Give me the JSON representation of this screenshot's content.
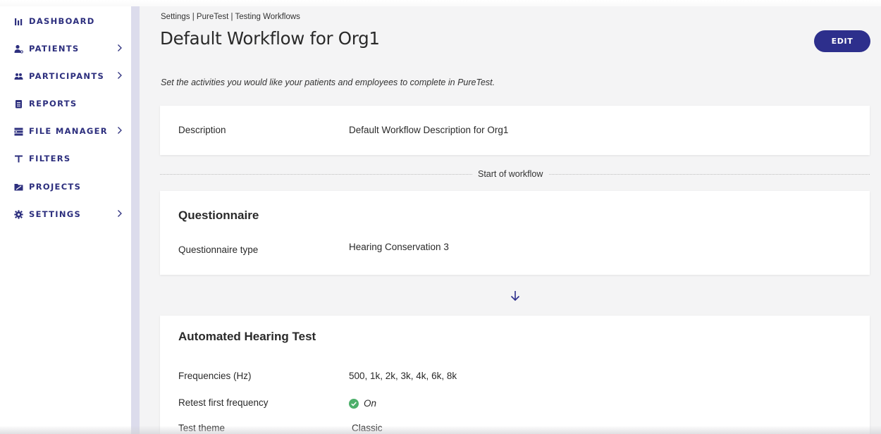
{
  "sidebar": {
    "items": [
      {
        "label": "DASHBOARD",
        "icon": "bar-chart-icon"
      },
      {
        "label": "PATIENTS",
        "icon": "patient-icon",
        "has_chevron": true
      },
      {
        "label": "PARTICIPANTS",
        "icon": "people-icon",
        "has_chevron": true
      },
      {
        "label": "REPORTS",
        "icon": "clipboard-icon"
      },
      {
        "label": "FILE MANAGER",
        "icon": "file-manager-icon",
        "has_chevron": true
      },
      {
        "label": "FILTERS",
        "icon": "filter-icon"
      },
      {
        "label": "PROJECTS",
        "icon": "folder-icon"
      },
      {
        "label": "SETTINGS",
        "icon": "gear-icon",
        "has_chevron": true
      }
    ]
  },
  "header": {
    "breadcrumb": "Settings | PureTest | Testing Workflows",
    "title": "Default Workflow for Org1",
    "edit_label": "EDIT",
    "intro": "Set the activities you would like your patients and employees to complete in PureTest."
  },
  "description_card": {
    "label": "Description",
    "value": "Default Workflow Description for Org1"
  },
  "workflow_start_label": "Start of workflow",
  "questionnaire_card": {
    "heading": "Questionnaire",
    "label": "Questionnaire type",
    "value": "Hearing Conservation 3"
  },
  "hearing_test_card": {
    "heading": "Automated Hearing Test",
    "rows": [
      {
        "label": "Frequencies (Hz)",
        "value": "500, 1k, 2k, 3k, 4k, 6k, 8k"
      },
      {
        "label": "Retest first frequency",
        "value": "On",
        "icon": "check-circle-icon"
      },
      {
        "label": "Test theme",
        "value": "Classic"
      }
    ]
  },
  "colors": {
    "brand": "#2d2f8c",
    "nav_text": "#2d2f7e",
    "success": "#4caf6a",
    "sidebar_rail": "#dcdcec",
    "main_background": "#f4f4f5"
  }
}
